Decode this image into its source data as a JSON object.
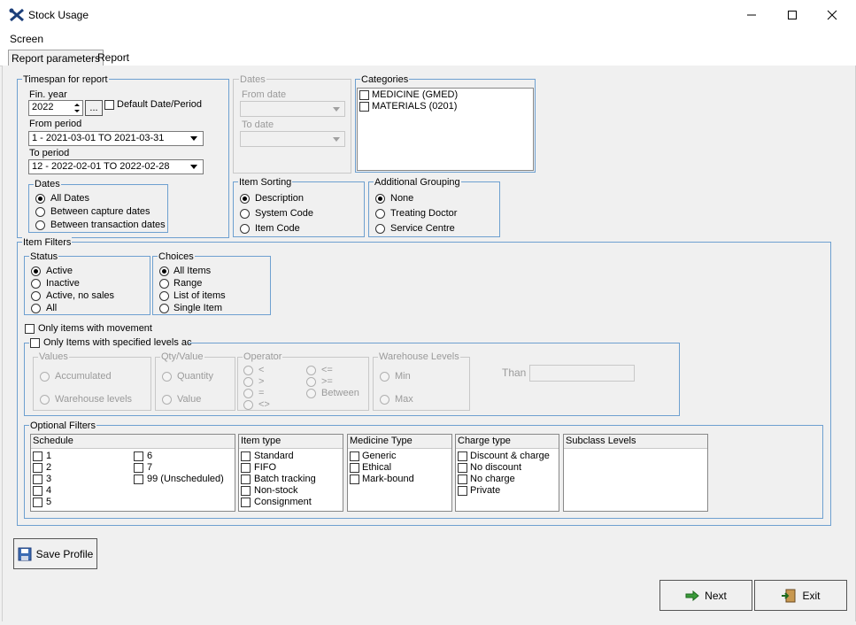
{
  "window": {
    "title": "Stock Usage",
    "min": "—",
    "max": "☐",
    "close": "✕"
  },
  "menu": {
    "screen": "Screen"
  },
  "tabs": {
    "params": "Report parameters",
    "report": "Report"
  },
  "timespan": {
    "legend": "Timespan for report",
    "fin_year_label": "Fin. year",
    "fin_year_value": "2022",
    "ellipsis": "...",
    "default_label": "Default Date/Period",
    "from_period_label": "From period",
    "from_period_value": "1  - 2021-03-01 TO 2021-03-31",
    "to_period_label": "To period",
    "to_period_value": "12 - 2022-02-01 TO 2022-02-28",
    "dates_legend": "Dates",
    "dates_options": [
      "All Dates",
      "Between capture dates",
      "Between transaction dates"
    ]
  },
  "dates_box": {
    "legend": "Dates",
    "from_label": "From date",
    "to_label": "To date"
  },
  "categories": {
    "legend": "Categories",
    "items": [
      "MEDICINE  (GMED)",
      "MATERIALS  (0201)"
    ]
  },
  "item_sorting": {
    "legend": "Item Sorting",
    "options": [
      "Description",
      "System Code",
      "Item Code"
    ]
  },
  "additional_grouping": {
    "legend": "Additional Grouping",
    "options": [
      "None",
      "Treating Doctor",
      "Service Centre"
    ]
  },
  "item_filters": {
    "legend": "Item Filters",
    "status_legend": "Status",
    "status_options": [
      "Active",
      "Inactive",
      "Active, no sales",
      "All"
    ],
    "choices_legend": "Choices",
    "choices_options": [
      "All Items",
      "Range",
      "List of items",
      "Single Item"
    ],
    "only_movement": "Only items with movement",
    "only_levels": "Only Items with specified levels ac",
    "values_legend": "Values",
    "values_options": [
      "Accumulated",
      "Warehouse levels"
    ],
    "qty_legend": "Qty/Value",
    "qty_options": [
      "Quantity",
      "Value"
    ],
    "operator_legend": "Operator",
    "operator_options": [
      "<",
      ">",
      "=",
      "<>",
      "<=",
      ">=",
      "Between"
    ],
    "wh_legend": "Warehouse Levels",
    "wh_options": [
      "Min",
      "Max"
    ],
    "than_label": "Than"
  },
  "optional_filters": {
    "legend": "Optional Filters",
    "schedule_header": "Schedule",
    "schedule_col1": [
      "1",
      "2",
      "3",
      "4",
      "5"
    ],
    "schedule_col2": [
      "6",
      "7",
      "99 (Unscheduled)"
    ],
    "item_type_header": "Item type",
    "item_type": [
      "Standard",
      "FIFO",
      "Batch tracking",
      "Non-stock",
      "Consignment"
    ],
    "medicine_type_header": "Medicine Type",
    "medicine_type": [
      "Generic",
      "Ethical",
      "Mark-bound"
    ],
    "charge_type_header": "Charge type",
    "charge_type": [
      "Discount & charge",
      "No discount",
      "No charge",
      "Private"
    ],
    "subclass_header": "Subclass Levels"
  },
  "buttons": {
    "save_profile": "Save Profile",
    "next": "Next",
    "exit": "Exit"
  }
}
